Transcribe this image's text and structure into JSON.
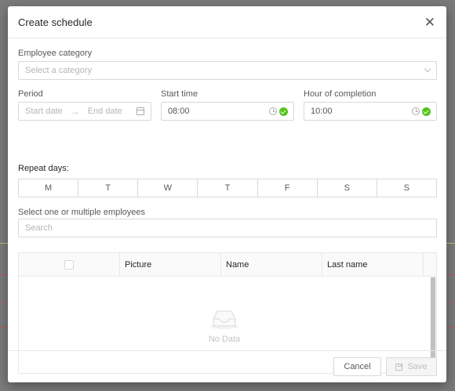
{
  "modal": {
    "title": "Create schedule"
  },
  "form": {
    "employee_category": {
      "label": "Employee category",
      "placeholder": "Select a category"
    },
    "period": {
      "label": "Period",
      "start_placeholder": "Start date",
      "separator": "→",
      "end_placeholder": "End date"
    },
    "start_time": {
      "label": "Start time",
      "value": "08:00"
    },
    "completion": {
      "label": "Hour of completion",
      "value": "10:00"
    },
    "repeat": {
      "label": "Repeat days:",
      "days": [
        "M",
        "T",
        "W",
        "T",
        "F",
        "S",
        "S"
      ]
    },
    "employees": {
      "label": "Select one or multiple employees",
      "placeholder": "Search"
    }
  },
  "table": {
    "columns": [
      "Picture",
      "Name",
      "Last name"
    ],
    "empty_text": "No Data"
  },
  "footer": {
    "cancel_label": "Cancel",
    "save_label": "Save"
  },
  "colors": {
    "success": "#52c41a",
    "overlay": "#7a7a7a",
    "bg_line_green": "#9fd17a",
    "bg_line_red": "#c0392b"
  }
}
